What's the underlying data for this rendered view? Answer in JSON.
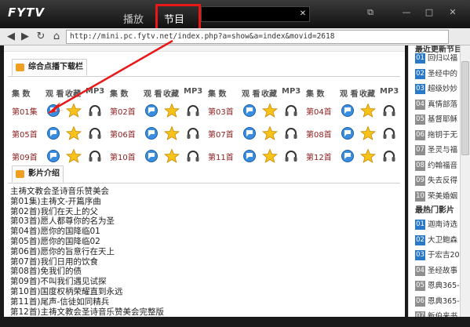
{
  "app": {
    "logo": "FYTV",
    "tabs": [
      "播放",
      "节目"
    ],
    "window_buttons": [
      "restore-icon",
      "minimize-icon",
      "maximize-icon",
      "close-icon"
    ]
  },
  "address": {
    "url": "http://mini.pc.fytv.net/index.php?a=show&a=index&movid=2618"
  },
  "download_section": {
    "title": "综合点播下载栏",
    "headers": [
      "集 数",
      "观 看",
      "收藏",
      "MP3"
    ],
    "episodes": [
      "第01集",
      "第02首",
      "第03首",
      "第04首",
      "第05首",
      "第06首",
      "第07首",
      "第08首",
      "第09首",
      "第10首",
      "第11首",
      "第12首"
    ],
    "icons": [
      "watch-icon",
      "favorite-star-icon",
      "mp3-headphones-icon"
    ]
  },
  "intro_section": {
    "title": "影片介绍",
    "lines": [
      "主祷文教会圣诗音乐赞美会",
      "第01集)主祷文-开篇序曲",
      "第02首)我们在天上的父",
      "第03首)愿人都尊你的名为圣",
      "第04首)愿你的国降临01",
      "第05首)愿你的国降临02",
      "第06首)愿你的旨意行在天上",
      "第07首)我们日用的饮食",
      "第08首)免我们的债",
      "第09首)不叫我们遇见试探",
      "第10首)国度权柄荣耀直到永远",
      "第11首)尾声-信徒如同精兵",
      "第12首)主祷文教会圣诗音乐赞美会完整版"
    ]
  },
  "right_panel": {
    "section1_title": "最近更新节目",
    "section1_items": [
      {
        "num": "01",
        "text": "回归以福"
      },
      {
        "num": "02",
        "text": "圣经中的"
      },
      {
        "num": "03",
        "text": "超级妙妙"
      },
      {
        "num": "04",
        "text": "真情部落"
      },
      {
        "num": "05",
        "text": "基督耶稣"
      },
      {
        "num": "06",
        "text": "拖钥于无"
      },
      {
        "num": "07",
        "text": "圣灵与福"
      },
      {
        "num": "08",
        "text": "约翰福音"
      },
      {
        "num": "09",
        "text": "失去反得"
      },
      {
        "num": "10",
        "text": "荣美婚姻"
      }
    ],
    "section2_title": "最热门影片",
    "section2_items": [
      {
        "num": "01",
        "text": "迦南诗选"
      },
      {
        "num": "02",
        "text": "大卫鲍森"
      },
      {
        "num": "03",
        "text": "于宏吉20"
      },
      {
        "num": "04",
        "text": "圣经故事"
      },
      {
        "num": "05",
        "text": "恩典365-"
      },
      {
        "num": "06",
        "text": "恩典365-"
      },
      {
        "num": "07",
        "text": "新伯来书"
      }
    ]
  },
  "colors": {
    "highlight_box": "#e81818",
    "episode_text": "#8b1d1d",
    "rank_top": "#2a78c8",
    "rank_other": "#8e8e8e",
    "titlebar": "#2a2a2a"
  }
}
